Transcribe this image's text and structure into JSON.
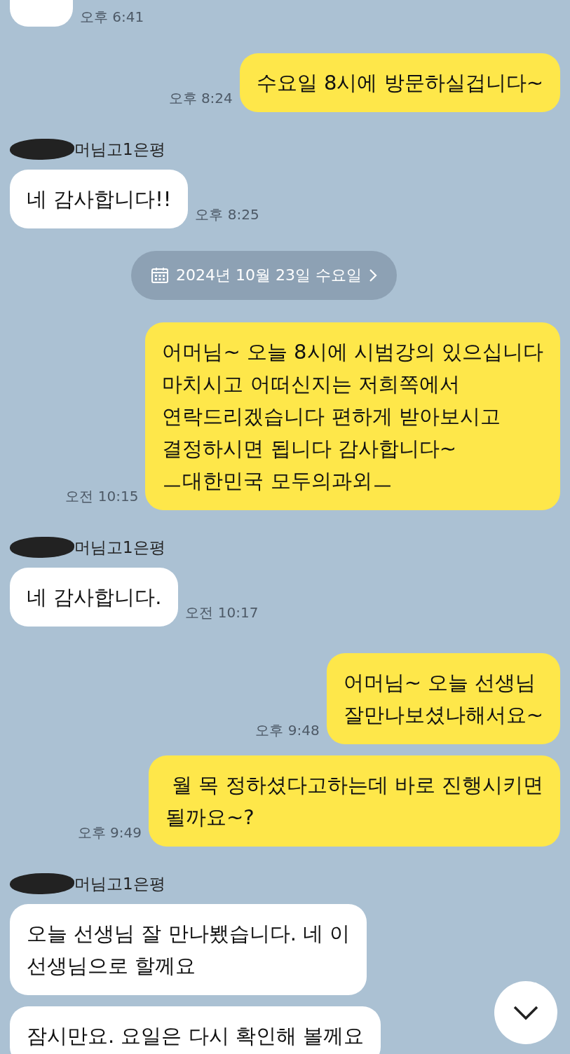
{
  "messages": [
    {
      "kind": "in_cut",
      "time": "오후 6:41"
    },
    {
      "kind": "out",
      "text": "수요일 8시에 방문하실겁니다~",
      "time": "오후 8:24"
    },
    {
      "kind": "in",
      "sender": "머님고1은평",
      "text": "네 감사합니다!!",
      "time": "오후 8:25"
    },
    {
      "kind": "date",
      "text": "2024년 10월 23일 수요일"
    },
    {
      "kind": "out",
      "text": "어머님~ 오늘 8시에 시범강의 있으십니다\n마치시고 어떠신지는 저희쪽에서\n연락드리겠습니다 편하게 받아보시고\n결정하시면 됩니다 감사합니다~\nㅡ대한민국 모두의과외ㅡ",
      "time": "오전 10:15"
    },
    {
      "kind": "in",
      "sender": "머님고1은평",
      "text": "네 감사합니다.",
      "time": "오전 10:17"
    },
    {
      "kind": "out",
      "text": "어머님~ 오늘 선생님\n잘만나보셨나해서요~",
      "time": "오후 9:48"
    },
    {
      "kind": "out",
      "text": " 월 목 정하셨다고하는데 바로 진행시키면\n될까요~?",
      "time": "오후 9:49"
    },
    {
      "kind": "in",
      "sender": "머님고1은평",
      "text": "오늘 선생님 잘 만나뵀습니다. 네 이\n선생님으로 할께요"
    },
    {
      "kind": "in",
      "text": "잠시만요. 요일은 다시 확인해 볼께요"
    }
  ]
}
